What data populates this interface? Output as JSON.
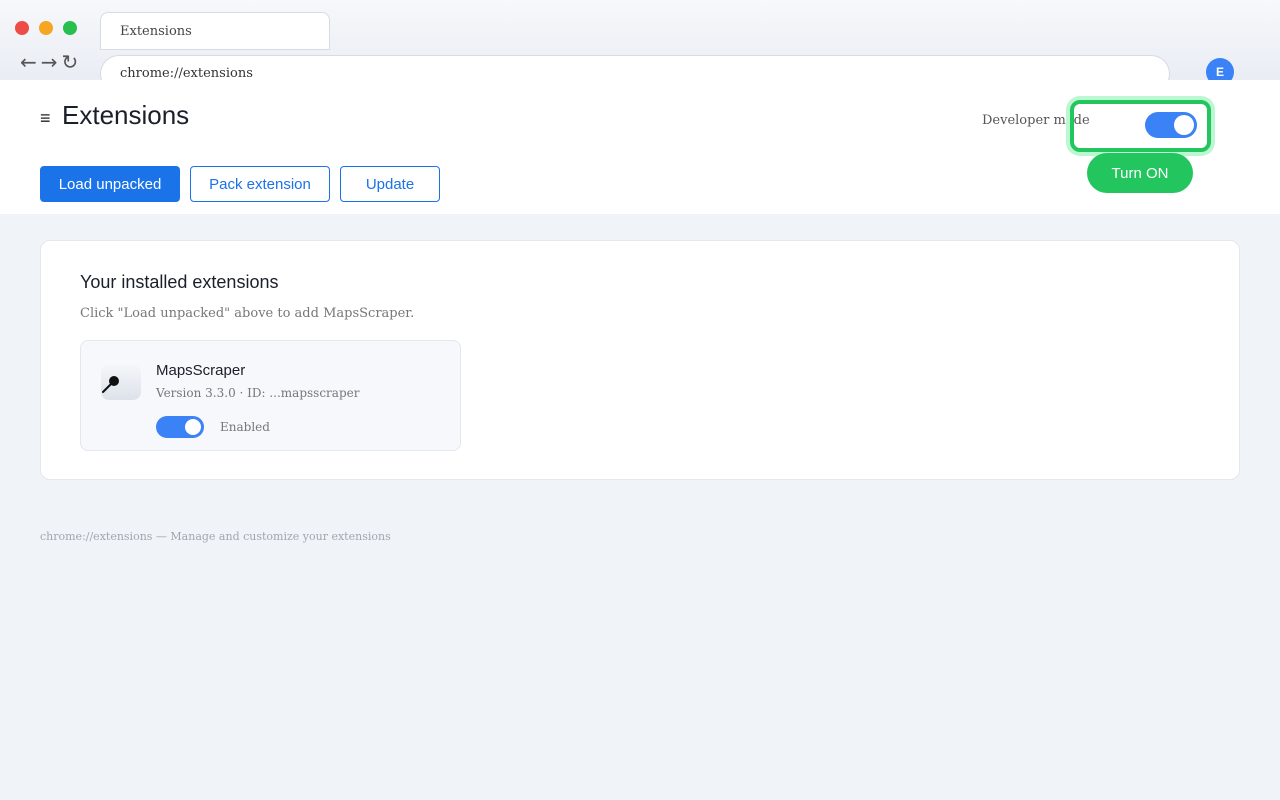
{
  "browser": {
    "tab_title": "Extensions",
    "nav": {
      "back": "←",
      "forward": "→",
      "reload": "↻"
    },
    "address": "chrome://extensions",
    "profile_initial": "E"
  },
  "header": {
    "menu_glyph": "≡",
    "title": "Extensions",
    "developer_mode_label": "Developer mode",
    "developer_mode_on": true,
    "turn_on_label": "Turn ON",
    "buttons": {
      "load_unpacked": "Load unpacked",
      "pack_extension": "Pack extension",
      "update": "Update"
    }
  },
  "installed": {
    "title": "Your installed extensions",
    "hint": "Click \"Load unpacked\" above to add MapsScraper.",
    "items": [
      {
        "name": "MapsScraper",
        "meta": "Version 3.3.0 · ID: ...mapsscraper",
        "enabled": true,
        "status": "Enabled",
        "icon": "magnifier-icon"
      }
    ]
  },
  "footer": "chrome://extensions — Manage and customize your extensions",
  "colors": {
    "accent": "#1a73e8",
    "toggle_on": "#3b82f6",
    "highlight": "#22c55e"
  }
}
